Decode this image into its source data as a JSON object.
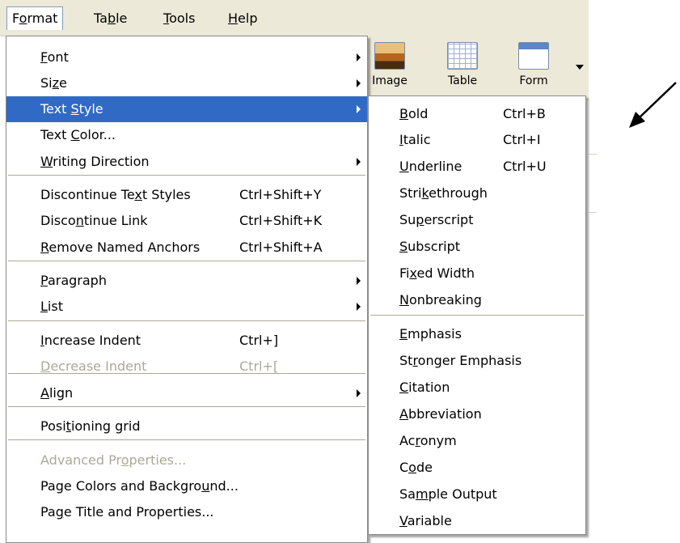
{
  "menubar": [
    {
      "pre": "F",
      "ul": "o",
      "post": "rmat"
    },
    {
      "pre": "Ta",
      "ul": "b",
      "post": "le"
    },
    {
      "pre": "",
      "ul": "T",
      "post": "ools"
    },
    {
      "pre": "",
      "ul": "H",
      "post": "elp"
    }
  ],
  "toolbar": [
    {
      "label": "Image",
      "icon": "image-icon"
    },
    {
      "label": "Table",
      "icon": "table-icon"
    },
    {
      "label": "Form",
      "icon": "form-icon"
    }
  ],
  "format_menu": [
    {
      "pre": "",
      "ul": "F",
      "post": "ont",
      "sub": true
    },
    {
      "pre": "Si",
      "ul": "z",
      "post": "e",
      "sub": true
    },
    {
      "pre": "Text ",
      "ul": "S",
      "post": "tyle",
      "sub": true,
      "highlighted": true
    },
    {
      "pre": "Text ",
      "ul": "C",
      "post": "olor...",
      "sub": false
    },
    {
      "pre": "",
      "ul": "W",
      "post": "riting Direction",
      "sub": true
    },
    {
      "pre": "Discontinue Te",
      "ul": "x",
      "post": "t Styles",
      "shortcut": "Ctrl+Shift+Y"
    },
    {
      "pre": "Disco",
      "ul": "n",
      "post": "tinue Link",
      "shortcut": "Ctrl+Shift+K"
    },
    {
      "pre": "",
      "ul": "R",
      "post": "emove Named Anchors",
      "shortcut": "Ctrl+Shift+A"
    },
    {
      "pre": "",
      "ul": "P",
      "post": "aragraph",
      "sub": true
    },
    {
      "pre": "",
      "ul": "L",
      "post": "ist",
      "sub": true
    },
    {
      "pre": "",
      "ul": "I",
      "post": "ncrease Indent",
      "shortcut": "Ctrl+]"
    },
    {
      "pre": "",
      "ul": "D",
      "post": "ecrease Indent",
      "shortcut": "Ctrl+[",
      "disabled": true
    },
    {
      "pre": "",
      "ul": "A",
      "post": "lign",
      "sub": true
    },
    {
      "pre": "Posi",
      "ul": "t",
      "post": "ioning grid"
    },
    {
      "pre": "Advanced Pr",
      "ul": "o",
      "post": "perties...",
      "disabled": true
    },
    {
      "pre": "Page Colors and Backgro",
      "ul": "u",
      "post": "nd..."
    },
    {
      "pre": "Pa",
      "ul": "g",
      "post": "e Title and Properties..."
    }
  ],
  "text_style_menu": [
    {
      "pre": "",
      "ul": "B",
      "post": "old",
      "shortcut": "Ctrl+B"
    },
    {
      "pre": "",
      "ul": "I",
      "post": "talic",
      "shortcut": "Ctrl+I"
    },
    {
      "pre": "",
      "ul": "U",
      "post": "nderline",
      "shortcut": "Ctrl+U"
    },
    {
      "pre": "Stri",
      "ul": "k",
      "post": "ethrough"
    },
    {
      "pre": "Su",
      "ul": "p",
      "post": "erscript"
    },
    {
      "pre": "",
      "ul": "S",
      "post": "ubscript"
    },
    {
      "pre": "Fi",
      "ul": "x",
      "post": "ed Width"
    },
    {
      "pre": "",
      "ul": "N",
      "post": "onbreaking"
    },
    {
      "pre": "",
      "ul": "E",
      "post": "mphasis"
    },
    {
      "pre": "St",
      "ul": "r",
      "post": "onger Emphasis"
    },
    {
      "pre": "",
      "ul": "C",
      "post": "itation"
    },
    {
      "pre": "",
      "ul": "A",
      "post": "bbreviation"
    },
    {
      "pre": "Ac",
      "ul": "r",
      "post": "onym"
    },
    {
      "pre": "C",
      "ul": "o",
      "post": "de"
    },
    {
      "pre": "Sa",
      "ul": "m",
      "post": "ple Output"
    },
    {
      "pre": "",
      "ul": "V",
      "post": "ariable"
    }
  ],
  "colors": {
    "highlight": "#316AC5",
    "menubar": "#ECE9D8",
    "disabled": "#aca899"
  },
  "annotation": {
    "icon": "pointer-arrow-icon"
  }
}
